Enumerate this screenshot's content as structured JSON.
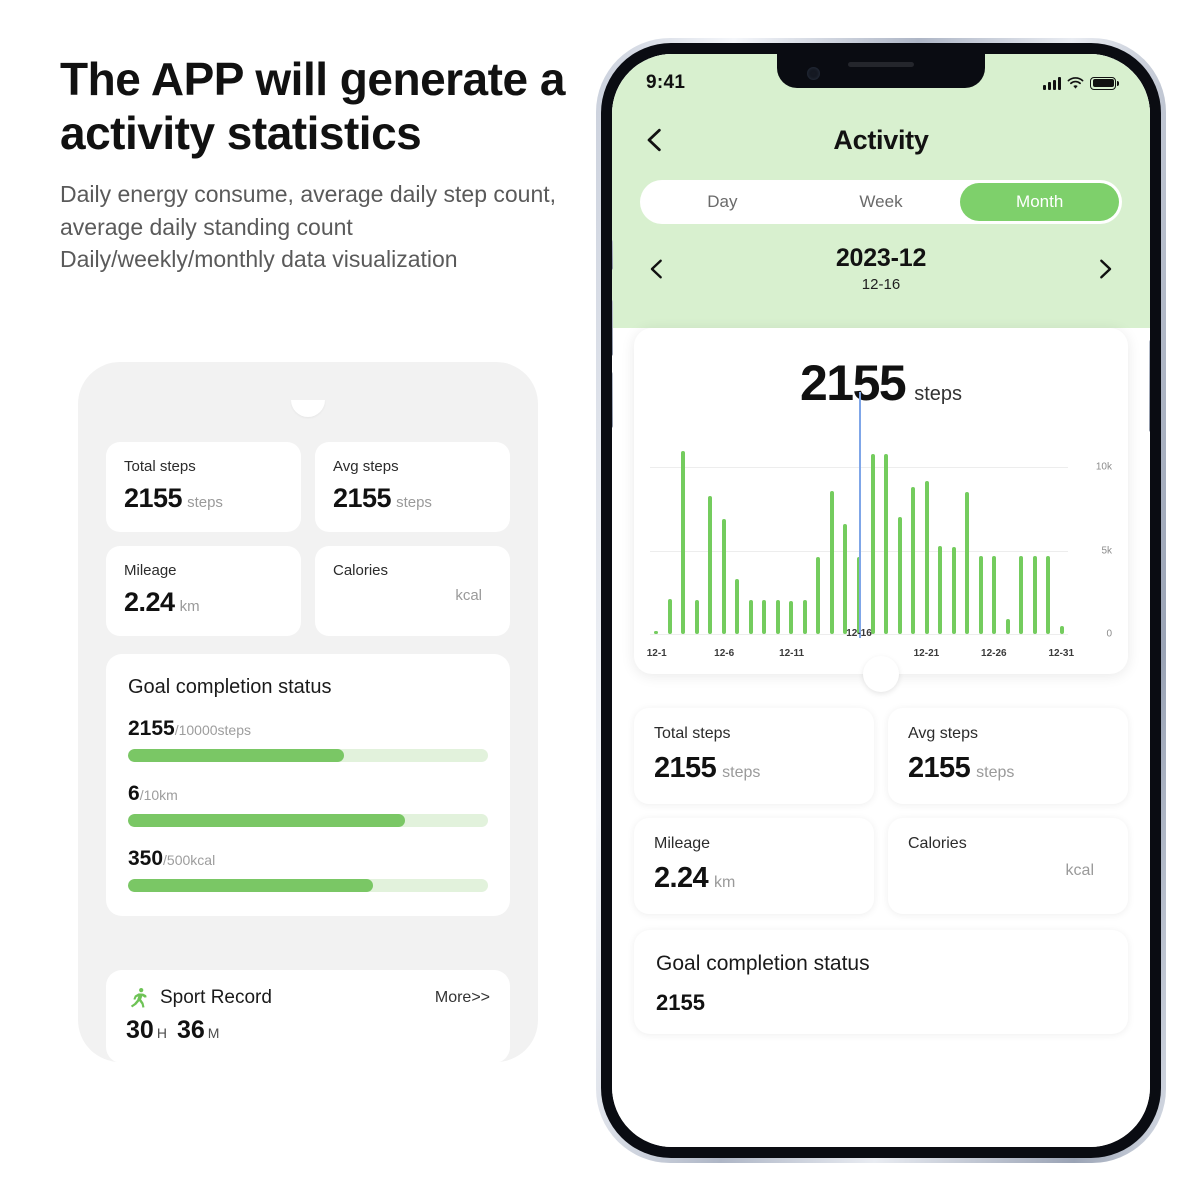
{
  "marketing": {
    "headline": "The APP will generate a activity statistics",
    "subcopy": "Daily energy consume, average daily step count, average daily standing count Daily/weekly/monthly data visualization"
  },
  "colors": {
    "accent_green": "#7ed06b",
    "bar_green": "#74cc5e",
    "track_green": "#e2f2dc",
    "header_bg": "#d8f0cf",
    "selection_line": "#7fa6e8"
  },
  "panel": {
    "stats": [
      {
        "label": "Total steps",
        "value": "2155",
        "unit": "steps"
      },
      {
        "label": "Avg steps",
        "value": "2155",
        "unit": "steps"
      },
      {
        "label": "Mileage",
        "value": "2.24",
        "unit": "km"
      },
      {
        "label": "Calories",
        "value": "",
        "unit": "kcal"
      }
    ],
    "goal": {
      "title": "Goal completion status",
      "rows": [
        {
          "current": "2155",
          "target": "/10000steps",
          "percent": 60
        },
        {
          "current": "6",
          "target": "/10km",
          "percent": 77
        },
        {
          "current": "350",
          "target": "/500kcal",
          "percent": 68
        }
      ]
    },
    "sport": {
      "icon": "running-icon",
      "name": "Sport Record",
      "more": "More>>",
      "hours": "30",
      "hours_unit": "H",
      "minutes": "36",
      "minutes_unit": "M"
    }
  },
  "phone": {
    "statusbar": {
      "time": "9:41",
      "signal_icon": "cellular-signal-icon",
      "wifi_icon": "wifi-icon",
      "battery_icon": "battery-icon"
    },
    "navbar": {
      "back_icon": "chevron-left-icon",
      "title": "Activity"
    },
    "segmented": {
      "options": [
        "Day",
        "Week",
        "Month"
      ],
      "selected": "Month"
    },
    "datenav": {
      "prev_icon": "chevron-left-icon",
      "next_icon": "chevron-right-icon",
      "month": "2023-12",
      "selected_day": "12-16"
    },
    "summary": {
      "value": "2155",
      "unit": "steps"
    },
    "stats": [
      {
        "label": "Total steps",
        "value": "2155",
        "unit": "steps"
      },
      {
        "label": "Avg steps",
        "value": "2155",
        "unit": "steps"
      },
      {
        "label": "Mileage",
        "value": "2.24",
        "unit": "km"
      },
      {
        "label": "Calories",
        "value": "",
        "unit": "kcal"
      }
    ],
    "goal": {
      "title": "Goal completion status",
      "cut_value": "2155"
    }
  },
  "chart_data": {
    "type": "bar",
    "title": "2155 steps",
    "xlabel": "",
    "ylabel": "",
    "ylim": [
      0,
      12000
    ],
    "grid": true,
    "legend": false,
    "ytick_labels": [
      "0",
      "5k",
      "10k"
    ],
    "ytick_values": [
      0,
      5000,
      10000
    ],
    "xtick_labels": [
      "12-1",
      "12-6",
      "12-11",
      "12-16",
      "12-21",
      "12-26",
      "12-31"
    ],
    "xtick_indices": [
      0,
      5,
      10,
      15,
      20,
      25,
      30
    ],
    "selection": {
      "index": 15,
      "label": "12-16",
      "color": "#7fa6e8"
    },
    "categories": [
      "12-1",
      "12-2",
      "12-3",
      "12-4",
      "12-5",
      "12-6",
      "12-7",
      "12-8",
      "12-9",
      "12-10",
      "12-11",
      "12-12",
      "12-13",
      "12-14",
      "12-15",
      "12-16",
      "12-17",
      "12-18",
      "12-19",
      "12-20",
      "12-21",
      "12-22",
      "12-23",
      "12-24",
      "12-25",
      "12-26",
      "12-27",
      "12-28",
      "12-29",
      "12-30",
      "12-31"
    ],
    "values": [
      200,
      2100,
      11000,
      2050,
      8300,
      6900,
      3300,
      2050,
      2050,
      2050,
      2000,
      2050,
      4600,
      8600,
      6600,
      4600,
      10800,
      10800,
      7000,
      8800,
      9200,
      5300,
      5200,
      8500,
      4700,
      4700,
      900,
      4700,
      4700,
      4700,
      500
    ]
  }
}
